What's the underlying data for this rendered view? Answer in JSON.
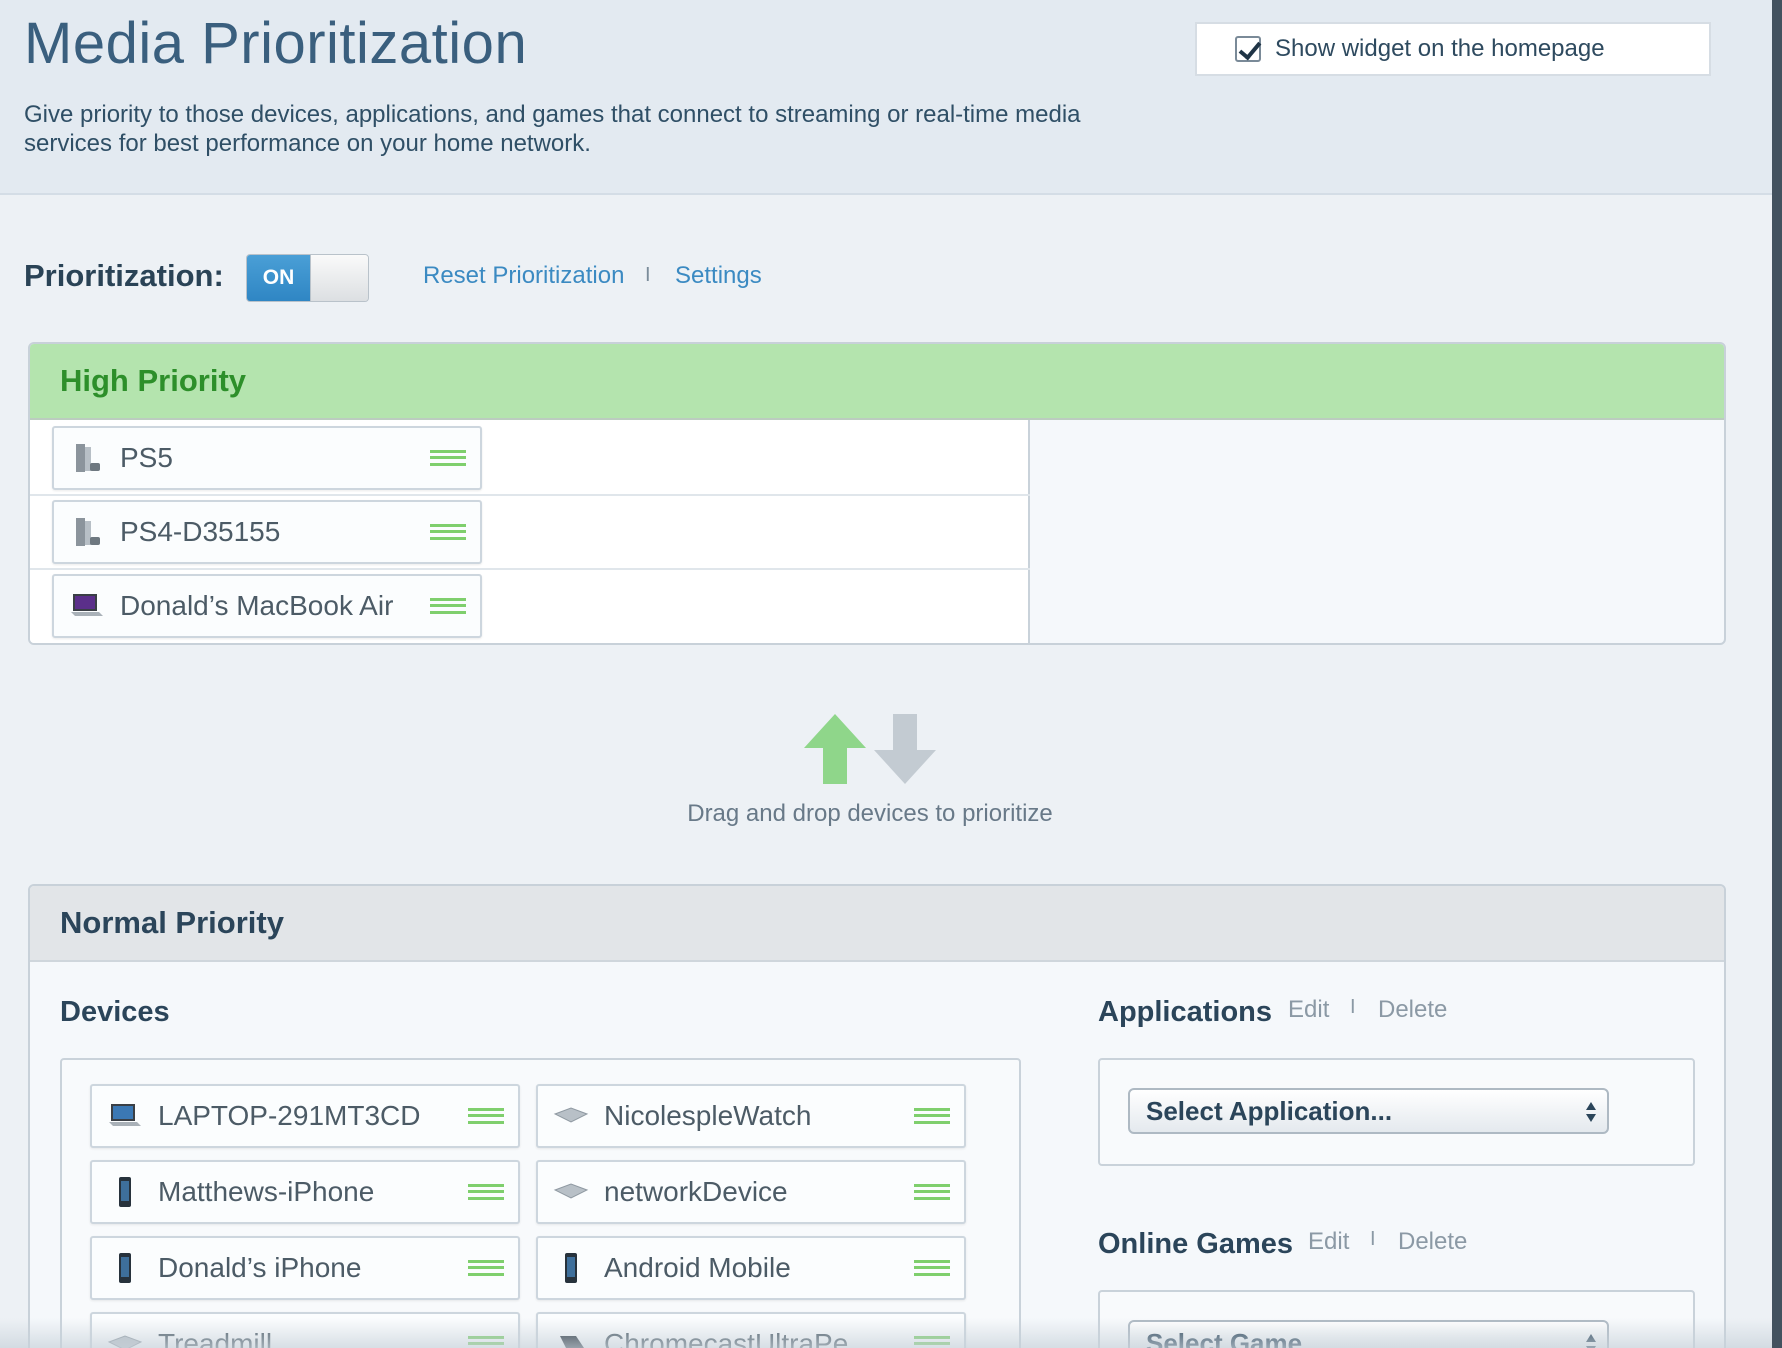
{
  "header": {
    "title": "Media Prioritization",
    "subtitle": "Give priority to those devices, applications, and games that connect to streaming or real-time media services for best performance on your home network.",
    "widget_checkbox_label": "Show widget on the homepage",
    "widget_checked": true
  },
  "prioritization": {
    "label": "Prioritization:",
    "toggle_state": "ON",
    "reset_link": "Reset Prioritization",
    "separator": "I",
    "settings_link": "Settings"
  },
  "high_priority": {
    "title": "High Priority",
    "devices": [
      {
        "name": "PS5",
        "icon": "game-console-icon"
      },
      {
        "name": "PS4-D35155",
        "icon": "game-console-icon"
      },
      {
        "name": "Donald’s MacBook Air",
        "icon": "laptop-icon"
      }
    ]
  },
  "drag_hint": {
    "text": "Drag and drop devices to prioritize"
  },
  "normal_priority": {
    "title": "Normal Priority",
    "devices_title": "Devices",
    "devices": [
      {
        "name": "LAPTOP-291MT3CD",
        "icon": "laptop-icon"
      },
      {
        "name": "NicolespleWatch",
        "icon": "generic-device-icon"
      },
      {
        "name": "Matthews-iPhone",
        "icon": "phone-icon"
      },
      {
        "name": "networkDevice",
        "icon": "generic-device-icon"
      },
      {
        "name": "Donald’s iPhone",
        "icon": "phone-icon"
      },
      {
        "name": "Android Mobile",
        "icon": "phone-icon"
      },
      {
        "name": "Treadmill",
        "icon": "generic-device-icon"
      },
      {
        "name": "ChromecastUltraPe",
        "icon": "media-device-icon"
      }
    ],
    "applications": {
      "title": "Applications",
      "edit": "Edit",
      "separator": "I",
      "delete": "Delete",
      "select_value": "Select Application..."
    },
    "games": {
      "title": "Online Games",
      "edit": "Edit",
      "separator": "I",
      "delete": "Delete",
      "select_value": "Select Game..."
    }
  },
  "colors": {
    "accent_blue": "#3b8ac2",
    "high_priority_green": "#b4e4ae",
    "high_priority_text": "#2d8f2a",
    "handle_green": "#7fcf6d"
  }
}
